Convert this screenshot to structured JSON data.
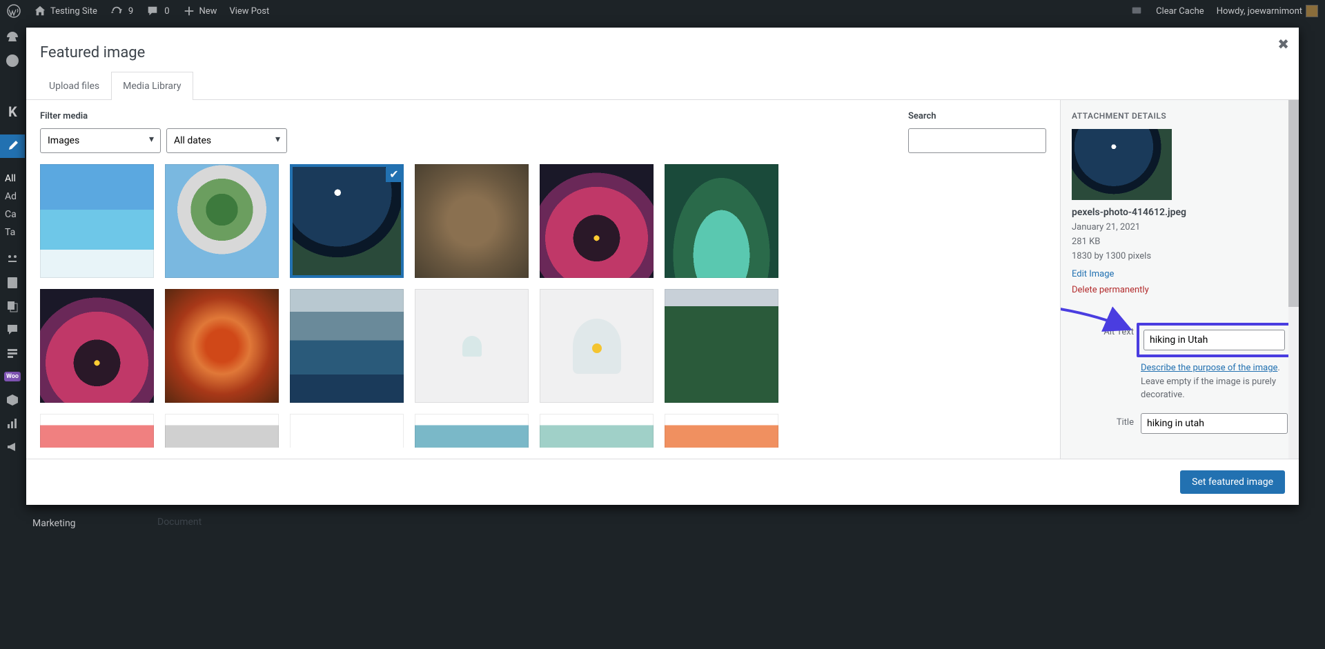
{
  "adminBar": {
    "siteName": "Testing Site",
    "updates": "9",
    "comments": "0",
    "newLabel": "New",
    "viewPost": "View Post",
    "clearCache": "Clear Cache",
    "howdy": "Howdy, joewarnimont"
  },
  "bgSidebar": {
    "all": "All",
    "ad": "Ad",
    "ca": "Ca",
    "ta": "Ta",
    "k": "K",
    "marketing": "Marketing",
    "document": "Document"
  },
  "modal": {
    "title": "Featured image",
    "tabs": {
      "upload": "Upload files",
      "media": "Media Library"
    },
    "filterLabel": "Filter media",
    "filterType": "Images",
    "filterDate": "All dates",
    "searchLabel": "Search",
    "searchValue": "",
    "submitLabel": "Set featured image"
  },
  "attachment": {
    "heading": "ATTACHMENT DETAILS",
    "filename": "pexels-photo-414612.jpeg",
    "date": "January 21, 2021",
    "size": "281 KB",
    "dimensions": "1830 by 1300 pixels",
    "editLink": "Edit Image",
    "deleteLink": "Delete permanently",
    "altLabel": "Alt Text",
    "altValue": "hiking in Utah",
    "altHelpLink": "Describe the purpose of the image",
    "altHelpRest": ". Leave empty if the image is purely decorative.",
    "titleLabel": "Title",
    "titleValue": "hiking in utah"
  }
}
